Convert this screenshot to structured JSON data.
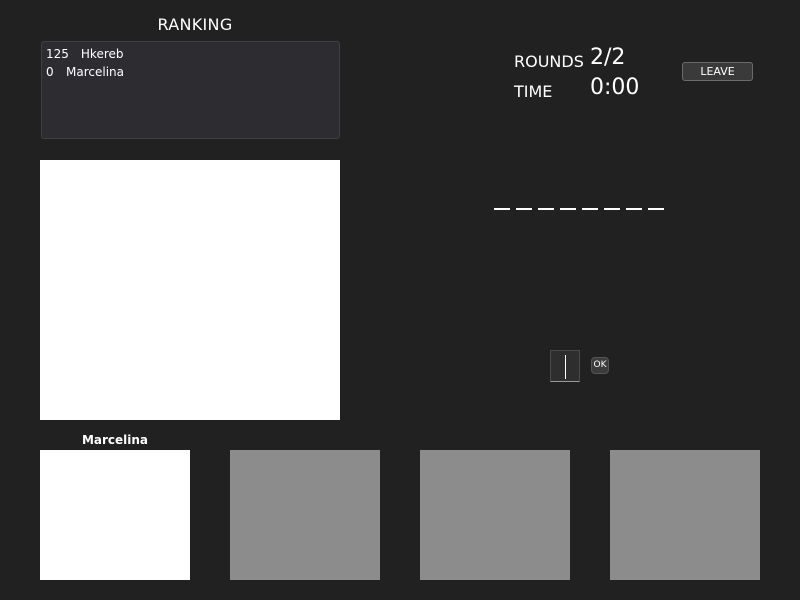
{
  "ranking": {
    "title": "RANKING",
    "entries": [
      {
        "score": "125",
        "name": "Hkereb"
      },
      {
        "score": "0",
        "name": "Marcelina"
      }
    ]
  },
  "stats": {
    "rounds_label": "ROUNDS",
    "rounds_value": "2/2",
    "time_label": "TIME",
    "time_value": "0:00"
  },
  "leave_label": "LEAVE",
  "word": {
    "blank_count": 8
  },
  "guess": {
    "value": "",
    "ok_label": "OK"
  },
  "players": {
    "active_name": "Marcelina",
    "slots": [
      "active",
      "empty",
      "empty",
      "empty"
    ]
  },
  "colors": {
    "background": "#212121",
    "canvas": "#ffffff",
    "empty_slot": "#8c8c8c"
  }
}
